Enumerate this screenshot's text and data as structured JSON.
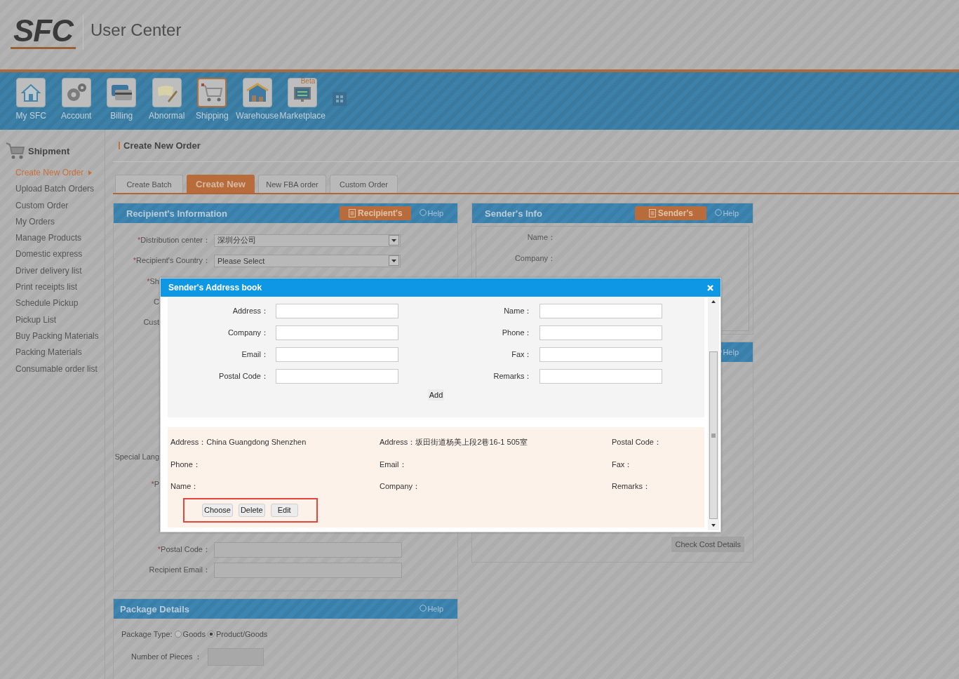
{
  "header": {
    "logo": "SFC",
    "title": "User Center"
  },
  "nav": [
    {
      "label": "My SFC",
      "selected": false
    },
    {
      "label": "Account",
      "selected": false
    },
    {
      "label": "Billing",
      "selected": false
    },
    {
      "label": "Abnormal",
      "selected": false
    },
    {
      "label": "Shipping",
      "selected": true
    },
    {
      "label": "Warehouse",
      "selected": false
    },
    {
      "label": "Marketplace",
      "selected": false,
      "badge": "Beta"
    }
  ],
  "sidebar": {
    "title": "Shipment",
    "items": [
      {
        "label": "Create New Order",
        "selected": true
      },
      {
        "label": "Upload Batch Orders",
        "selected": false
      },
      {
        "label": "Custom Order",
        "selected": false
      },
      {
        "label": "My Orders",
        "selected": false
      },
      {
        "label": "Manage Products",
        "selected": false
      },
      {
        "label": "Domestic express",
        "selected": false
      },
      {
        "label": "Driver delivery list",
        "selected": false
      },
      {
        "label": "Print receipts list",
        "selected": false
      },
      {
        "label": "Schedule Pickup",
        "selected": false
      },
      {
        "label": "Pickup List",
        "selected": false
      },
      {
        "label": "Buy Packing Materials",
        "selected": false
      },
      {
        "label": "Packing Materials",
        "selected": false
      },
      {
        "label": "Consumable order list",
        "selected": false
      }
    ]
  },
  "page_title": "Create New Order",
  "tabs": [
    {
      "label": "Create Batch",
      "selected": false
    },
    {
      "label": "Create New",
      "selected": true
    },
    {
      "label": "New FBA order",
      "selected": false
    },
    {
      "label": "Custom Order",
      "selected": false
    }
  ],
  "recipient_panel": {
    "title": "Recipient's Information",
    "button": "Recipient's",
    "help": "Help",
    "fields": [
      {
        "kind": "select",
        "mark": "*",
        "label": "Distribution center：",
        "value": "深圳分公司"
      },
      {
        "kind": "select",
        "mark": "*",
        "label": "Recipient's Country：",
        "value": "Please Select"
      },
      {
        "kind": "cut",
        "mark": "*",
        "label": "Sh"
      },
      {
        "kind": "cut",
        "label": "C"
      },
      {
        "kind": "cut",
        "label": "Cust"
      }
    ],
    "lower_fields": [
      {
        "kind": "cut",
        "label": "Special Lang"
      },
      {
        "kind": "cut",
        "mark": "*",
        "label": "P"
      },
      {
        "kind": "input",
        "mark": "*",
        "label": "Postal Code："
      },
      {
        "kind": "input",
        "label": "Recipient Email："
      }
    ]
  },
  "sender_panel": {
    "title": "Sender's Info",
    "button": "Sender's",
    "help": "Help",
    "fields": [
      "Name：",
      "Company："
    ]
  },
  "cost_panel": {
    "help": "Help",
    "button": "Check Cost Details"
  },
  "package_panel": {
    "title": "Package Details",
    "help": "Help",
    "type_label": "Package Type:",
    "options": [
      {
        "label": "Goods",
        "selected": false
      },
      {
        "label": "Product/Goods",
        "selected": true
      }
    ],
    "pieces_label": "Number of Pieces  ："
  },
  "dialog": {
    "title": "Sender's Address book",
    "form_left": [
      "Address：",
      "Company：",
      "Email：",
      "Postal Code："
    ],
    "form_right": [
      "Name：",
      "Phone：",
      "Fax：",
      "Remarks："
    ],
    "add": "Add",
    "entry": [
      [
        "Address：China Guangdong Shenzhen",
        "Address：坂田街道杨美上段2巷16-1 505室",
        "Postal Code："
      ],
      [
        "Phone：",
        "Email：",
        "Fax："
      ],
      [
        "Name：",
        "Company：",
        "Remarks："
      ]
    ],
    "actions": [
      "Choose",
      "Delete",
      "Edit"
    ],
    "highlighted": true
  }
}
